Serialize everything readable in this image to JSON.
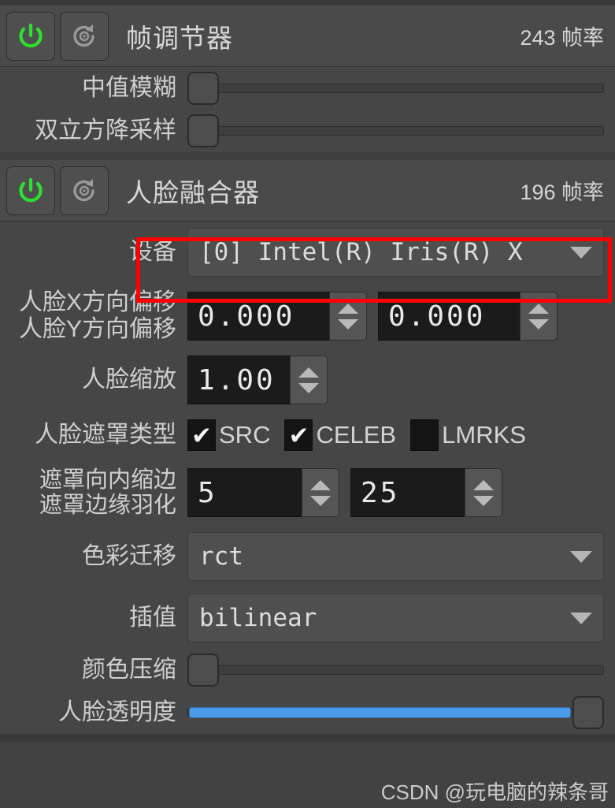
{
  "sections": [
    {
      "id": "frame-adjuster",
      "title": "帧调节器",
      "fps": "243 帧率",
      "power_icon": "power-icon",
      "reset_icon": "reset-icon",
      "power_on_color": "#2ee02e",
      "rows": [
        {
          "label": "中值模糊",
          "type": "slider",
          "fill_percent": 0,
          "handle_percent": 0
        },
        {
          "label": "双立方降采样",
          "type": "slider",
          "fill_percent": 0,
          "handle_percent": 0
        }
      ]
    },
    {
      "id": "face-merger",
      "title": "人脸融合器",
      "fps": "196 帧率",
      "power_icon": "power-icon",
      "reset_icon": "reset-icon",
      "power_on_color": "#2ee02e"
    }
  ],
  "device_row": {
    "label": "设备",
    "value": "[0] Intel(R) Iris(R) X",
    "arrow_icon": "chevron-down-icon",
    "highlight_color": "#fe0000"
  },
  "offset_row": {
    "label_x": "人脸X方向偏移",
    "label_y": "人脸Y方向偏移",
    "value_x": "0.000",
    "value_y": "0.000"
  },
  "scale_row": {
    "label": "人脸缩放",
    "value": "1.00"
  },
  "mask_type_row": {
    "label": "人脸遮罩类型",
    "options": [
      {
        "label": "SRC",
        "checked": true,
        "mark": "✔"
      },
      {
        "label": "CELEB",
        "checked": true,
        "mark": "✔"
      },
      {
        "label": "LMRKS",
        "checked": false,
        "mark": ""
      }
    ]
  },
  "mask_size_row": {
    "label_erode": "遮罩向内缩边",
    "label_blur": "遮罩边缘羽化",
    "value_erode": "5",
    "value_blur": "25"
  },
  "color_transfer_row": {
    "label": "色彩迁移",
    "value": "rct",
    "arrow_icon": "chevron-down-icon"
  },
  "interpolation_row": {
    "label": "插值",
    "value": "bilinear",
    "arrow_icon": "chevron-down-icon"
  },
  "color_compression_row": {
    "label": "颜色压缩",
    "type": "slider",
    "fill_percent": 0,
    "handle_percent": 0
  },
  "face_opacity_row": {
    "label": "人脸透明度",
    "type": "slider",
    "fill_percent": 100,
    "handle_percent": 100,
    "fill_color": "#4a9ae8"
  },
  "watermark": "CSDN @玩电脑的辣条哥"
}
